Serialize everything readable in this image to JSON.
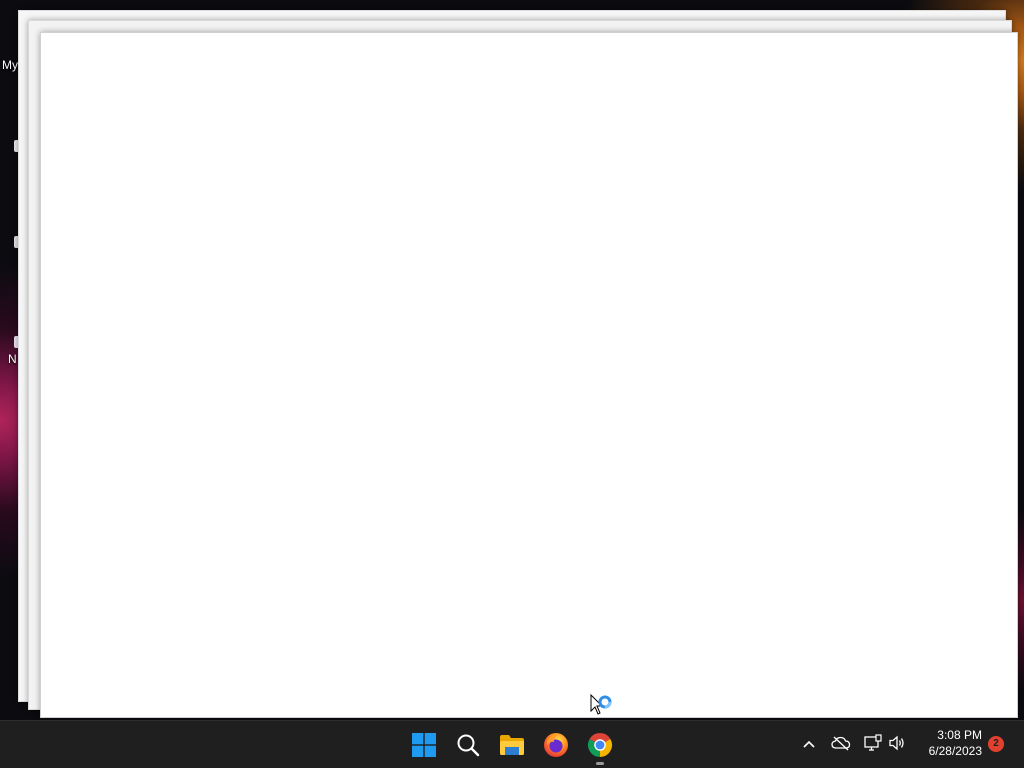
{
  "desktop": {
    "icons": [
      {
        "label": "My"
      },
      {
        "label": "N"
      }
    ]
  },
  "taskbar": {
    "apps": [
      {
        "name": "start-button",
        "icon": "windows-logo-icon",
        "running": false
      },
      {
        "name": "search-button",
        "icon": "search-icon",
        "running": false
      },
      {
        "name": "file-explorer-button",
        "icon": "folder-icon",
        "running": false
      },
      {
        "name": "firefox-button",
        "icon": "firefox-icon",
        "running": false
      },
      {
        "name": "chrome-button",
        "icon": "chrome-icon",
        "running": true
      }
    ],
    "tray": {
      "icons": [
        "chevron-up-icon",
        "cloud-off-icon",
        "network-icon",
        "volume-icon"
      ]
    },
    "clock": {
      "time": "3:08 PM",
      "date": "6/28/2023"
    },
    "notifications": {
      "count": "2"
    }
  },
  "colors": {
    "taskbar_bg": "#1f1f1f",
    "windows_blue": "#1e90ff",
    "notification_red": "#e0412e"
  }
}
